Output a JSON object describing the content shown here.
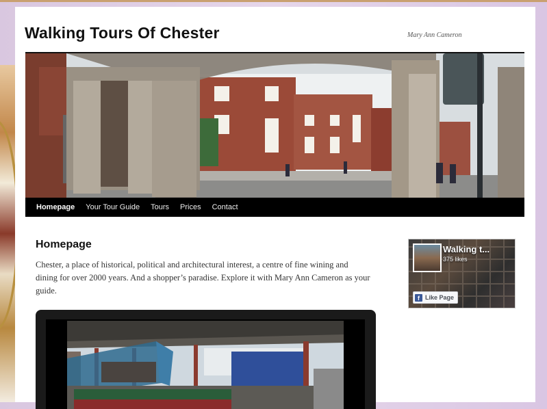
{
  "site": {
    "title": "Walking Tours Of Chester",
    "description": "Mary Ann Cameron"
  },
  "nav": {
    "items": [
      {
        "label": "Homepage",
        "active": true
      },
      {
        "label": "Your Tour Guide"
      },
      {
        "label": "Tours"
      },
      {
        "label": "Prices"
      },
      {
        "label": "Contact"
      }
    ]
  },
  "content": {
    "title": "Homepage",
    "text": "Chester, a place of historical, political and architectural interest, a centre of fine wining and dining for over 2000 years.  And a shopper’s paradise.  Explore it with Mary Ann Cameron as your guide."
  },
  "facebook": {
    "page_name": "Walking t...",
    "likes": "375 likes",
    "like_label": "Like Page",
    "icon": "facebook-f-icon"
  },
  "colors": {
    "nav_bg": "#000000",
    "page_bg": "#ffffff",
    "body_bg": "#e6d6ea",
    "facebook_blue": "#3b5998"
  }
}
